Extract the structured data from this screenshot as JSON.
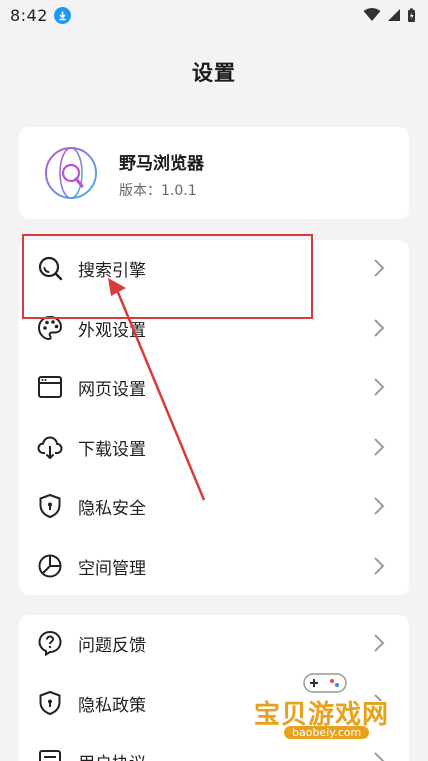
{
  "status_bar": {
    "time": "8:42"
  },
  "page_title": "设置",
  "app_info": {
    "name": "野马浏览器",
    "version": "版本：1.0.1"
  },
  "menu_group_1": [
    {
      "label": "搜索引擎",
      "icon": "search-icon"
    },
    {
      "label": "外观设置",
      "icon": "palette-icon"
    },
    {
      "label": "网页设置",
      "icon": "browser-window-icon"
    },
    {
      "label": "下载设置",
      "icon": "cloud-download-icon"
    },
    {
      "label": "隐私安全",
      "icon": "shield-lock-icon"
    },
    {
      "label": "空间管理",
      "icon": "pie-chart-icon"
    }
  ],
  "menu_group_2": [
    {
      "label": "问题反馈",
      "icon": "question-bubble-icon"
    },
    {
      "label": "隐私政策",
      "icon": "shield-lock-icon"
    },
    {
      "label": "用户协议",
      "icon": "document-icon"
    }
  ],
  "watermark": {
    "text": "宝贝游戏网",
    "url": "baobeiy.com"
  },
  "colors": {
    "background": "#f3f3f5",
    "card": "#ffffff",
    "annotation": "#d93a3a",
    "accent": "#1e9bf0"
  }
}
